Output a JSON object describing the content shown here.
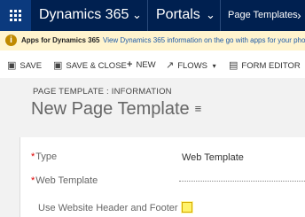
{
  "nav": {
    "app_title": "Dynamics 365",
    "app_chevron": "⌄",
    "area_label": "Portals",
    "area_chevron": "⌄",
    "breadcrumb_item": "Page Templates",
    "breadcrumb_arrow": "›"
  },
  "banner": {
    "bold_text": "Apps for Dynamics 365",
    "link_text": "View Dynamics 365 information on the go with apps for your pho"
  },
  "command_bar": {
    "save_label": "SAVE",
    "save_close_label": "SAVE & CLOSE",
    "new_label": "NEW",
    "flows_label": "FLOWS",
    "flows_chevron": "▾",
    "form_editor_label": "FORM EDITOR"
  },
  "header": {
    "entity_label": "PAGE TEMPLATE : INFORMATION",
    "record_title": "New Page Template",
    "record_menu_glyph": "≡"
  },
  "form": {
    "fields": [
      {
        "label": "Type",
        "value": "Web Template",
        "required": "*"
      },
      {
        "label": "Web Template",
        "value": "",
        "required": "*"
      },
      {
        "label": "Use Website Header and Footer",
        "value": "",
        "required": ""
      }
    ]
  },
  "colors": {
    "nav_bg": "#002050",
    "banner_bg": "#fff4ce",
    "link": "#1e5aa8",
    "required": "#dd0000"
  },
  "icons": {
    "apps": "waffle-icon",
    "info": "info-icon",
    "save": "floppy-disk-icon",
    "save_close": "floppy-disk-close-icon",
    "new": "plus-icon",
    "flows": "flow-icon",
    "form_editor": "form-editor-icon"
  }
}
